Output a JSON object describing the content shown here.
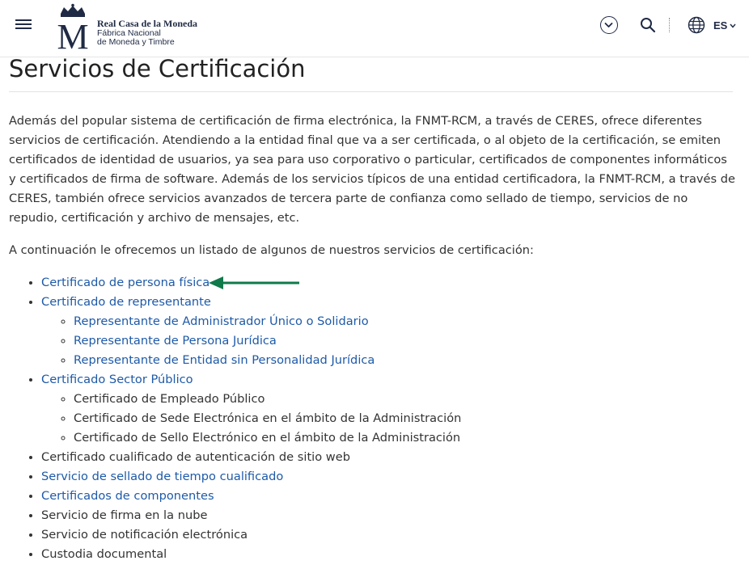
{
  "header": {
    "brand_title": "Real Casa de la Moneda",
    "brand_line1": "Fábrica Nacional",
    "brand_line2": "de Moneda y Timbre",
    "logo_letter": "M",
    "language": "ES"
  },
  "icons": {
    "menu": "hamburger-menu-icon",
    "collapse": "chevron-down-circle-icon",
    "search": "search-icon",
    "language": "globe-icon",
    "arrow": "green-arrow-icon"
  },
  "colors": {
    "link": "#1e5aa8",
    "text": "#333333",
    "brand": "#1f2a44",
    "arrow": "#0f7a4a"
  },
  "page": {
    "title": "Servicios de Certificación",
    "intro": "Además del popular sistema de certificación de firma electrónica, la FNMT-RCM, a través de CERES, ofrece diferentes servicios de certificación. Atendiendo a la entidad final que va a ser certificada, o al objeto de la certificación, se emiten certificados de identidad de usuarios, ya sea para uso corporativo o particular, certificados de componentes informáticos y certificados de firma de software. Además de los servicios típicos de una entidad certificadora, la FNMT-RCM, a través de CERES, también ofrece servicios avanzados de tercera parte de confianza como sellado de tiempo, servicios de no repudio, certificación y archivo de mensajes, etc.",
    "lead": "A continuación le ofrecemos un listado de algunos de nuestros servicios de certificación:"
  },
  "services": {
    "persona_fisica": "Certificado de persona física",
    "representante": "Certificado de representante",
    "rep_admin": "Representante de Administrador Único o Solidario",
    "rep_juridica": "Representante de Persona Jurídica",
    "rep_entidad": "Representante de Entidad sin Personalidad Jurídica",
    "sector_publico": "Certificado Sector Público",
    "empleado_publico": "Certificado de Empleado Público",
    "sede_electronica": "Certificado de Sede Electrónica en el ámbito de la Administración",
    "sello_electronico": "Certificado de Sello Electrónico en el ámbito de la Administración",
    "sitio_web": "Certificado cualificado de autenticación de sitio web",
    "sellado_tiempo": "Servicio de sellado de tiempo cualificado",
    "componentes": "Certificados de componentes",
    "firma_nube": "Servicio de firma en la nube",
    "notificacion": "Servicio de notificación electrónica",
    "custodia": "Custodia documental"
  }
}
